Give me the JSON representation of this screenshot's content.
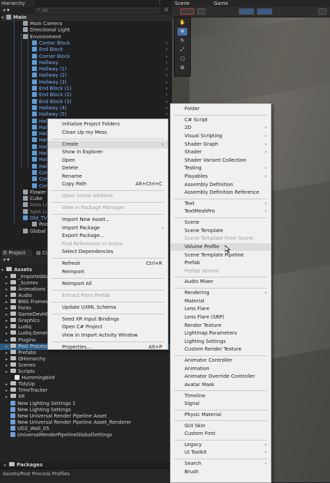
{
  "hierarchy": {
    "tab": "Hierarchy",
    "search_placeholder": "All",
    "scene_name": "Main",
    "items": [
      {
        "label": "Main Camera",
        "style": "norm"
      },
      {
        "label": "Directional Light",
        "style": "norm"
      },
      {
        "label": "Environment",
        "style": "norm"
      },
      {
        "label": "Center Block",
        "style": "blue"
      },
      {
        "label": "End Block",
        "style": "blue"
      },
      {
        "label": "Corner Block",
        "style": "blue"
      },
      {
        "label": "Hallway",
        "style": "blue"
      },
      {
        "label": "Hallway (1)",
        "style": "blue"
      },
      {
        "label": "Hallway (2)",
        "style": "blue"
      },
      {
        "label": "Hallway (3)",
        "style": "blue"
      },
      {
        "label": "End Block (1)",
        "style": "blue"
      },
      {
        "label": "End Block (2)",
        "style": "blue"
      },
      {
        "label": "End Block (3)",
        "style": "blue"
      },
      {
        "label": "Hallway (4)",
        "style": "blue"
      },
      {
        "label": "Hallway (5)",
        "style": "blue"
      },
      {
        "label": "Hall",
        "style": "blue"
      },
      {
        "label": "Hall",
        "style": "blue"
      },
      {
        "label": "Hall",
        "style": "blue"
      },
      {
        "label": "Hall",
        "style": "blue"
      },
      {
        "label": "Hall",
        "style": "blue"
      },
      {
        "label": "Hall",
        "style": "blue"
      },
      {
        "label": "Hall",
        "style": "blue"
      },
      {
        "label": "Hall",
        "style": "blue"
      },
      {
        "label": "Com",
        "style": "blue"
      },
      {
        "label": "Com",
        "style": "blue"
      },
      {
        "label": "Com",
        "style": "blue"
      },
      {
        "label": "Flower",
        "style": "norm"
      },
      {
        "label": "Cube",
        "style": "norm"
      },
      {
        "label": "Area Li",
        "style": "grey"
      },
      {
        "label": "Spot Li",
        "style": "grey"
      },
      {
        "label": "Old_TV",
        "style": "blue"
      },
      {
        "label": "Poin",
        "style": "norm"
      },
      {
        "label": "Global V",
        "style": "norm"
      }
    ]
  },
  "scene": {
    "tab_scene": "Scene",
    "tab_game": "Game"
  },
  "project": {
    "tab_project": "Project",
    "tab_console": "Co",
    "assets_label": "Assets",
    "items": [
      {
        "label": "_ImportedAss",
        "type": "folder",
        "indent": 1
      },
      {
        "label": "_Scenes",
        "type": "folder",
        "indent": 1
      },
      {
        "label": "Animations",
        "type": "folder",
        "indent": 1
      },
      {
        "label": "Audio",
        "type": "folder",
        "indent": 1
      },
      {
        "label": "BNG Framew",
        "type": "folder",
        "indent": 1
      },
      {
        "label": "Fonts",
        "type": "folder",
        "indent": 1
      },
      {
        "label": "GameDevHQ",
        "type": "folder",
        "indent": 1
      },
      {
        "label": "Graphics",
        "type": "folder",
        "indent": 1
      },
      {
        "label": "Ludiq",
        "type": "folder",
        "indent": 1
      },
      {
        "label": "Ludiq.Generat",
        "type": "folder",
        "indent": 1
      },
      {
        "label": "Plugins",
        "type": "folder",
        "indent": 1
      },
      {
        "label": "Post Process Profiles",
        "type": "folder",
        "indent": 1,
        "selected": true
      },
      {
        "label": "Prefabs",
        "type": "folder",
        "indent": 1
      },
      {
        "label": "QHierarchy",
        "type": "folder",
        "indent": 1
      },
      {
        "label": "Scenes",
        "type": "folder",
        "indent": 1
      },
      {
        "label": "Scripts",
        "type": "folder",
        "indent": 1
      },
      {
        "label": "Hummingbird",
        "type": "script",
        "indent": 2
      },
      {
        "label": "TidyUp",
        "type": "folder",
        "indent": 1
      },
      {
        "label": "TimeTracker",
        "type": "folder",
        "indent": 1
      },
      {
        "label": "XR",
        "type": "folder",
        "indent": 1
      },
      {
        "label": "New Lighting Settings 1",
        "type": "asset",
        "indent": 1
      },
      {
        "label": "New Lighting Settings",
        "type": "asset",
        "indent": 1
      },
      {
        "label": "New Universal Render Pipeline Asset",
        "type": "asset",
        "indent": 1
      },
      {
        "label": "New Universal Render Pipeline Asset_Renderer",
        "type": "asset",
        "indent": 1
      },
      {
        "label": "UD2_Wall_05",
        "type": "asset",
        "indent": 1
      },
      {
        "label": "UniversalRenderPipelineGlobalSettings",
        "type": "asset",
        "indent": 1
      }
    ],
    "packages_label": "Packages",
    "status_path": "Assets/Post Process Profiles"
  },
  "context_menu": {
    "items": [
      {
        "label": "Initialize Project Folders"
      },
      {
        "label": "Clean Up my Mess"
      },
      {
        "sep": true
      },
      {
        "label": "Create",
        "submenu": true,
        "highlight": true
      },
      {
        "label": "Show in Explorer"
      },
      {
        "label": "Open"
      },
      {
        "label": "Delete"
      },
      {
        "label": "Rename"
      },
      {
        "label": "Copy Path",
        "shortcut": "Alt+Ctrl+C"
      },
      {
        "sep": true
      },
      {
        "label": "Open Scene Additive",
        "disabled": true
      },
      {
        "sep": true
      },
      {
        "label": "View in Package Manager",
        "disabled": true
      },
      {
        "sep": true
      },
      {
        "label": "Import New Asset..."
      },
      {
        "label": "Import Package",
        "submenu": true
      },
      {
        "label": "Export Package..."
      },
      {
        "label": "Find References In Scene",
        "disabled": true
      },
      {
        "label": "Select Dependencies"
      },
      {
        "sep": true
      },
      {
        "label": "Refresh",
        "shortcut": "Ctrl+R"
      },
      {
        "label": "Reimport"
      },
      {
        "sep": true
      },
      {
        "label": "Reimport All"
      },
      {
        "sep": true
      },
      {
        "label": "Extract From Prefab",
        "disabled": true
      },
      {
        "sep": true
      },
      {
        "label": "Update UXML Schema"
      },
      {
        "sep": true
      },
      {
        "label": "Seed XR Input Bindings"
      },
      {
        "label": "Open C# Project"
      },
      {
        "label": "View in Import Activity Window"
      },
      {
        "sep": true
      },
      {
        "label": "Properties...",
        "shortcut": "Alt+P"
      }
    ]
  },
  "create_menu": {
    "items": [
      {
        "label": "Folder"
      },
      {
        "sep": true
      },
      {
        "label": "C# Script"
      },
      {
        "label": "2D",
        "submenu": true
      },
      {
        "label": "Visual Scripting",
        "submenu": true
      },
      {
        "label": "Shader Graph",
        "submenu": true
      },
      {
        "label": "Shader",
        "submenu": true
      },
      {
        "label": "Shader Variant Collection"
      },
      {
        "label": "Testing",
        "submenu": true
      },
      {
        "label": "Playables",
        "submenu": true
      },
      {
        "label": "Assembly Definition"
      },
      {
        "label": "Assembly Definition Reference"
      },
      {
        "sep": true
      },
      {
        "label": "Text",
        "submenu": true
      },
      {
        "label": "TextMeshPro",
        "submenu": true
      },
      {
        "sep": true
      },
      {
        "label": "Scene"
      },
      {
        "label": "Scene Template"
      },
      {
        "label": "Scene Template From Scene",
        "disabled": true
      },
      {
        "label": "Volume Profile",
        "highlight": true
      },
      {
        "label": "Scene Template Pipeline"
      },
      {
        "label": "Prefab"
      },
      {
        "label": "Prefab Variant",
        "disabled": true
      },
      {
        "sep": true
      },
      {
        "label": "Audio Mixer"
      },
      {
        "sep": true
      },
      {
        "label": "Rendering",
        "submenu": true
      },
      {
        "label": "Material"
      },
      {
        "label": "Lens Flare"
      },
      {
        "label": "Lens Flare (SRP)"
      },
      {
        "label": "Render Texture"
      },
      {
        "label": "Lightmap Parameters"
      },
      {
        "label": "Lighting Settings"
      },
      {
        "label": "Custom Render Texture"
      },
      {
        "sep": true
      },
      {
        "label": "Animator Controller"
      },
      {
        "label": "Animation"
      },
      {
        "label": "Animator Override Controller"
      },
      {
        "label": "Avatar Mask"
      },
      {
        "sep": true
      },
      {
        "label": "Timeline"
      },
      {
        "label": "Signal"
      },
      {
        "sep": true
      },
      {
        "label": "Physic Material"
      },
      {
        "sep": true
      },
      {
        "label": "GUI Skin"
      },
      {
        "label": "Custom Font"
      },
      {
        "sep": true
      },
      {
        "label": "Legacy",
        "submenu": true
      },
      {
        "label": "UI Toolkit",
        "submenu": true
      },
      {
        "sep": true
      },
      {
        "label": "Search",
        "submenu": true
      },
      {
        "label": "Brush"
      }
    ]
  }
}
